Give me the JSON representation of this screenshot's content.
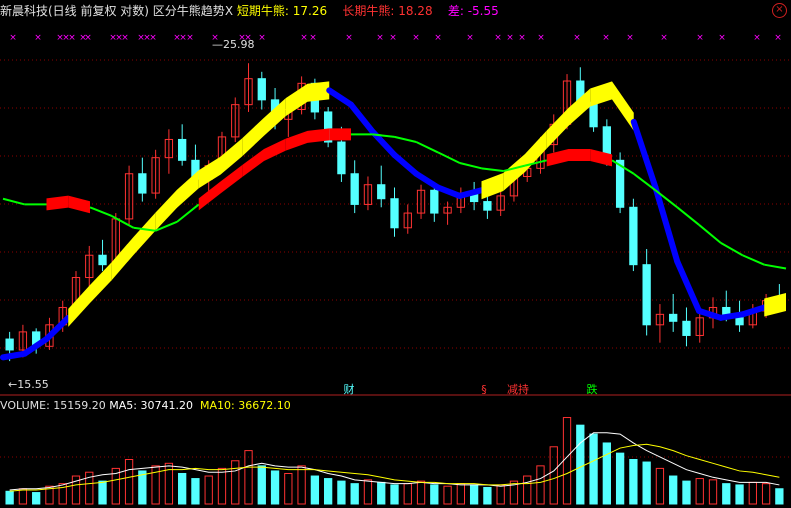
{
  "header": {
    "title": "新晨科技(日线 前复权 对数) 区分牛熊趋势",
    "close_glyph": "X",
    "short_label": "短期牛熊: ",
    "short_value": "17.26",
    "long_label": "长期牛熊: ",
    "long_value": "18.28",
    "diff_label": "差: ",
    "diff_value": "-5.55"
  },
  "volume_header": {
    "volume_label": "VOLUME: ",
    "volume_value": "15159.20",
    "ma5_label": "MA5: ",
    "ma5_value": "30741.20",
    "ma10_label": "MA10: ",
    "ma10_value": "36672.10"
  },
  "markers": {
    "high_label": "25.98",
    "low_label": "15.55",
    "tags": [
      "财",
      "§",
      "减持",
      "跌"
    ]
  },
  "colors": {
    "background": "#000000",
    "up_candle": "#ff3232",
    "down_candle": "#54ffff",
    "bull_band": "#ffff00",
    "bear_band": "#ff0000",
    "short_line_down": "#0000ff",
    "long_line_up": "#ff0000",
    "long_line_down": "#00ff00",
    "header_short": "#ffff00",
    "header_long": "#ff3232",
    "header_diff": "#ff00ff",
    "ma5": "#ffffff",
    "ma10": "#ffff00",
    "grid": "#8b0000",
    "cross_marks": "#ff00ff"
  },
  "chart_data": {
    "type": "candlestick",
    "title": "新晨科技(日线 前复权 对数) 区分牛熊趋势",
    "log_scale": true,
    "price_range": [
      15.0,
      27.5
    ],
    "series": [
      {
        "name": "短期牛熊",
        "last": 17.26
      },
      {
        "name": "长期牛熊",
        "last": 18.28
      },
      {
        "name": "差",
        "last": -5.55
      }
    ],
    "short_trend": [
      15.7,
      15.8,
      16.2,
      16.8,
      17.5,
      18.2,
      19.0,
      19.8,
      20.6,
      21.3,
      21.8,
      22.5,
      23.3,
      24.1,
      24.7,
      24.8,
      24.2,
      23.1,
      22.2,
      21.5,
      21.0,
      20.7,
      20.9,
      21.2,
      21.9,
      22.8,
      23.7,
      24.5,
      24.8,
      23.5,
      21.0,
      18.5,
      17.0,
      16.8,
      16.9,
      17.1,
      17.26
    ],
    "short_bull_flags": [
      false,
      false,
      false,
      true,
      true,
      true,
      true,
      true,
      true,
      true,
      true,
      true,
      true,
      true,
      true,
      false,
      false,
      false,
      false,
      false,
      false,
      false,
      true,
      true,
      true,
      true,
      true,
      true,
      true,
      false,
      false,
      false,
      false,
      false,
      false,
      true,
      true
    ],
    "long_trend": [
      20.6,
      20.4,
      20.4,
      20.5,
      20.3,
      20.0,
      19.6,
      19.5,
      19.8,
      20.4,
      21.0,
      21.6,
      22.2,
      22.6,
      22.9,
      23.0,
      23.0,
      23.0,
      22.9,
      22.7,
      22.3,
      21.9,
      21.7,
      21.6,
      21.8,
      22.0,
      22.2,
      22.2,
      22.0,
      21.5,
      20.9,
      20.3,
      19.7,
      19.1,
      18.7,
      18.4,
      18.28
    ],
    "long_bull_flags": [
      false,
      false,
      true,
      true,
      false,
      false,
      false,
      false,
      false,
      true,
      true,
      true,
      true,
      true,
      true,
      true,
      false,
      false,
      false,
      false,
      false,
      false,
      false,
      false,
      false,
      true,
      true,
      true,
      false,
      false,
      false,
      false,
      false,
      false,
      false,
      false,
      false
    ],
    "high": 25.98,
    "low": 15.55,
    "ohlc": [
      [
        16.2,
        16.4,
        15.6,
        15.9
      ],
      [
        15.9,
        16.6,
        15.7,
        16.4
      ],
      [
        16.4,
        16.5,
        15.8,
        16.0
      ],
      [
        16.0,
        16.8,
        15.9,
        16.6
      ],
      [
        16.6,
        17.3,
        16.4,
        17.1
      ],
      [
        17.1,
        18.2,
        17.0,
        18.0
      ],
      [
        18.0,
        19.0,
        17.7,
        18.7
      ],
      [
        18.7,
        19.2,
        18.2,
        18.4
      ],
      [
        18.4,
        20.1,
        18.3,
        19.9
      ],
      [
        19.9,
        21.8,
        19.7,
        21.5
      ],
      [
        21.5,
        22.1,
        20.5,
        20.8
      ],
      [
        20.8,
        22.4,
        20.6,
        22.1
      ],
      [
        22.1,
        23.2,
        21.5,
        22.8
      ],
      [
        22.8,
        23.4,
        21.8,
        22.0
      ],
      [
        22.0,
        22.6,
        20.9,
        21.3
      ],
      [
        21.3,
        22.0,
        20.7,
        21.8
      ],
      [
        21.8,
        23.1,
        21.6,
        22.9
      ],
      [
        22.9,
        24.5,
        22.7,
        24.2
      ],
      [
        24.2,
        25.98,
        23.9,
        25.3
      ],
      [
        25.3,
        25.6,
        24.0,
        24.4
      ],
      [
        24.4,
        24.9,
        23.2,
        23.6
      ],
      [
        23.6,
        24.2,
        22.9,
        24.0
      ],
      [
        24.0,
        25.4,
        23.8,
        25.1
      ],
      [
        25.1,
        25.3,
        23.6,
        23.9
      ],
      [
        23.9,
        24.1,
        22.5,
        22.7
      ],
      [
        22.7,
        23.3,
        21.2,
        21.5
      ],
      [
        21.5,
        22.0,
        20.1,
        20.4
      ],
      [
        20.4,
        21.4,
        20.2,
        21.1
      ],
      [
        21.1,
        21.8,
        20.3,
        20.6
      ],
      [
        20.6,
        21.0,
        19.3,
        19.6
      ],
      [
        19.6,
        20.4,
        19.4,
        20.1
      ],
      [
        20.1,
        21.1,
        19.9,
        20.9
      ],
      [
        20.9,
        21.2,
        19.8,
        20.1
      ],
      [
        20.1,
        20.5,
        19.7,
        20.3
      ],
      [
        20.3,
        21.0,
        20.1,
        20.8
      ],
      [
        20.8,
        21.2,
        20.2,
        20.5
      ],
      [
        20.5,
        20.8,
        19.9,
        20.2
      ],
      [
        20.2,
        20.9,
        20.0,
        20.7
      ],
      [
        20.7,
        21.6,
        20.5,
        21.4
      ],
      [
        21.4,
        22.1,
        21.2,
        21.7
      ],
      [
        21.7,
        22.9,
        21.5,
        22.6
      ],
      [
        22.6,
        23.8,
        22.3,
        23.4
      ],
      [
        23.4,
        25.5,
        23.2,
        25.2
      ],
      [
        25.2,
        25.8,
        24.1,
        24.3
      ],
      [
        24.3,
        24.9,
        23.1,
        23.3
      ],
      [
        23.3,
        23.6,
        21.8,
        22.0
      ],
      [
        22.0,
        22.3,
        20.1,
        20.3
      ],
      [
        20.3,
        20.6,
        18.2,
        18.4
      ],
      [
        18.4,
        18.9,
        16.3,
        16.6
      ],
      [
        16.6,
        17.2,
        16.1,
        16.9
      ],
      [
        16.9,
        17.5,
        16.4,
        16.7
      ],
      [
        16.7,
        17.1,
        16.0,
        16.3
      ],
      [
        16.3,
        17.0,
        16.1,
        16.8
      ],
      [
        16.8,
        17.4,
        16.5,
        17.1
      ],
      [
        17.1,
        17.6,
        16.7,
        16.9
      ],
      [
        16.9,
        17.3,
        16.4,
        16.6
      ],
      [
        16.6,
        17.2,
        16.5,
        17.0
      ],
      [
        17.0,
        17.5,
        16.8,
        17.3
      ],
      [
        17.3,
        17.8,
        17.0,
        17.2
      ]
    ],
    "volume": [
      10,
      12,
      9,
      14,
      16,
      22,
      25,
      18,
      28,
      35,
      26,
      30,
      32,
      24,
      20,
      22,
      28,
      34,
      42,
      30,
      26,
      24,
      30,
      22,
      20,
      18,
      16,
      19,
      17,
      15,
      16,
      18,
      15,
      14,
      16,
      15,
      13,
      15,
      18,
      22,
      30,
      45,
      68,
      62,
      55,
      48,
      40,
      35,
      33,
      28,
      22,
      18,
      20,
      19,
      16,
      15,
      17,
      16,
      12
    ],
    "ma5_values": [
      11,
      12,
      12,
      13,
      15,
      18,
      21,
      23,
      24,
      27,
      28,
      29,
      30,
      29,
      27,
      25,
      25,
      26,
      30,
      32,
      30,
      29,
      29,
      27,
      24,
      22,
      19,
      18,
      17,
      16,
      16,
      17,
      16,
      16,
      15,
      15,
      15,
      14,
      15,
      17,
      20,
      26,
      37,
      48,
      56,
      56,
      55,
      48,
      42,
      37,
      32,
      27,
      24,
      21,
      19,
      17,
      17,
      17,
      15
    ],
    "ma10_values": [
      10,
      11,
      11,
      12,
      13,
      15,
      16,
      17,
      19,
      21,
      23,
      25,
      27,
      27,
      28,
      27,
      27,
      28,
      29,
      29,
      28,
      27,
      27,
      27,
      26,
      25,
      24,
      23,
      21,
      19,
      18,
      17,
      17,
      16,
      16,
      16,
      15,
      15,
      16,
      16,
      17,
      20,
      24,
      29,
      34,
      39,
      44,
      46,
      47,
      45,
      42,
      38,
      35,
      32,
      29,
      26,
      25,
      23,
      21
    ]
  }
}
